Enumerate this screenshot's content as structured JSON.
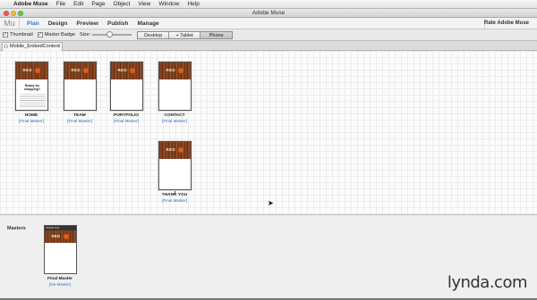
{
  "menubar": {
    "app_name": "Adobe Muse",
    "items": [
      "File",
      "Edit",
      "Page",
      "Object",
      "View",
      "Window",
      "Help"
    ]
  },
  "window": {
    "title": "Adobe Muse"
  },
  "nav": {
    "logo": "Mu",
    "tabs": [
      "Plan",
      "Design",
      "Preview",
      "Publish",
      "Manage"
    ],
    "active_tab": "Plan",
    "rate": "Rate Adobe Muse"
  },
  "options": {
    "thumbnail": "Thumbnail",
    "master_badge": "Master Badge",
    "size": "Size:",
    "layouts": [
      "Desktop",
      "+ Tablet",
      "Phone"
    ],
    "selected_layout": "Phone"
  },
  "document_tab": {
    "label": "Mobile_EmbedContent",
    "close": "×"
  },
  "thumb_logo": "RED",
  "pages": [
    {
      "name": "HOME",
      "master": "[Final Master]",
      "heading": "Ready for shopping?"
    },
    {
      "name": "TEAM",
      "master": "[Final Master]"
    },
    {
      "name": "PORTFOLIO",
      "master": "[Final Master]"
    },
    {
      "name": "CONTACT",
      "master": "[Final Master]"
    },
    {
      "name": "THANK YOU",
      "master": "[Final Master]"
    }
  ],
  "masters": {
    "label": "Masters",
    "items": [
      {
        "name": "Final Master",
        "master": "[No Master]",
        "strip": "Mobile Nav"
      }
    ]
  },
  "watermark": "lynda.com",
  "colors": {
    "accent": "#2c7bd6",
    "link": "#2c6fd1"
  }
}
